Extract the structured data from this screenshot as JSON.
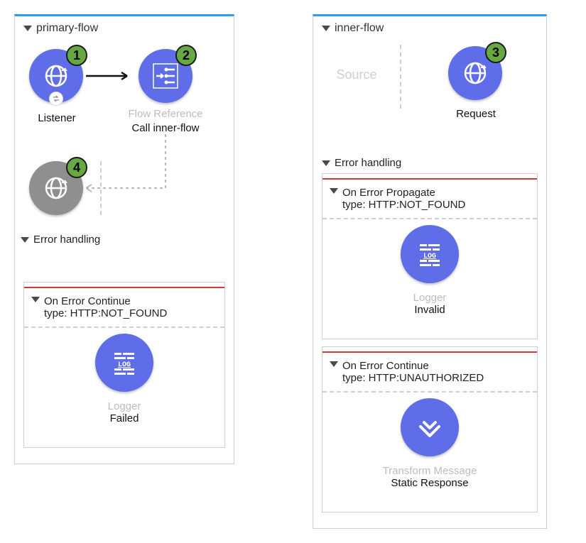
{
  "primary": {
    "title": "primary-flow",
    "listener": {
      "name": "Listener",
      "badge": "1"
    },
    "flowref": {
      "type": "Flow Reference",
      "name": "Call inner-flow",
      "badge": "2"
    },
    "grayListener": {
      "badge": "4"
    },
    "errSection": "Error handling",
    "onErrorContinue": {
      "label": "On Error Continue",
      "type": "type: HTTP:NOT_FOUND",
      "logger": {
        "type": "Logger",
        "name": "Failed"
      }
    }
  },
  "inner": {
    "title": "inner-flow",
    "sourcePlaceholder": "Source",
    "request": {
      "name": "Request",
      "badge": "3"
    },
    "errSection": "Error handling",
    "onErrorPropagate": {
      "label": "On Error Propagate",
      "type": "type: HTTP:NOT_FOUND",
      "logger": {
        "type": "Logger",
        "name": "Invalid"
      }
    },
    "onErrorContinue": {
      "label": "On Error Continue",
      "type": "type: HTTP:UNAUTHORIZED",
      "transform": {
        "type": "Transform Message",
        "name": "Static Response"
      }
    }
  }
}
